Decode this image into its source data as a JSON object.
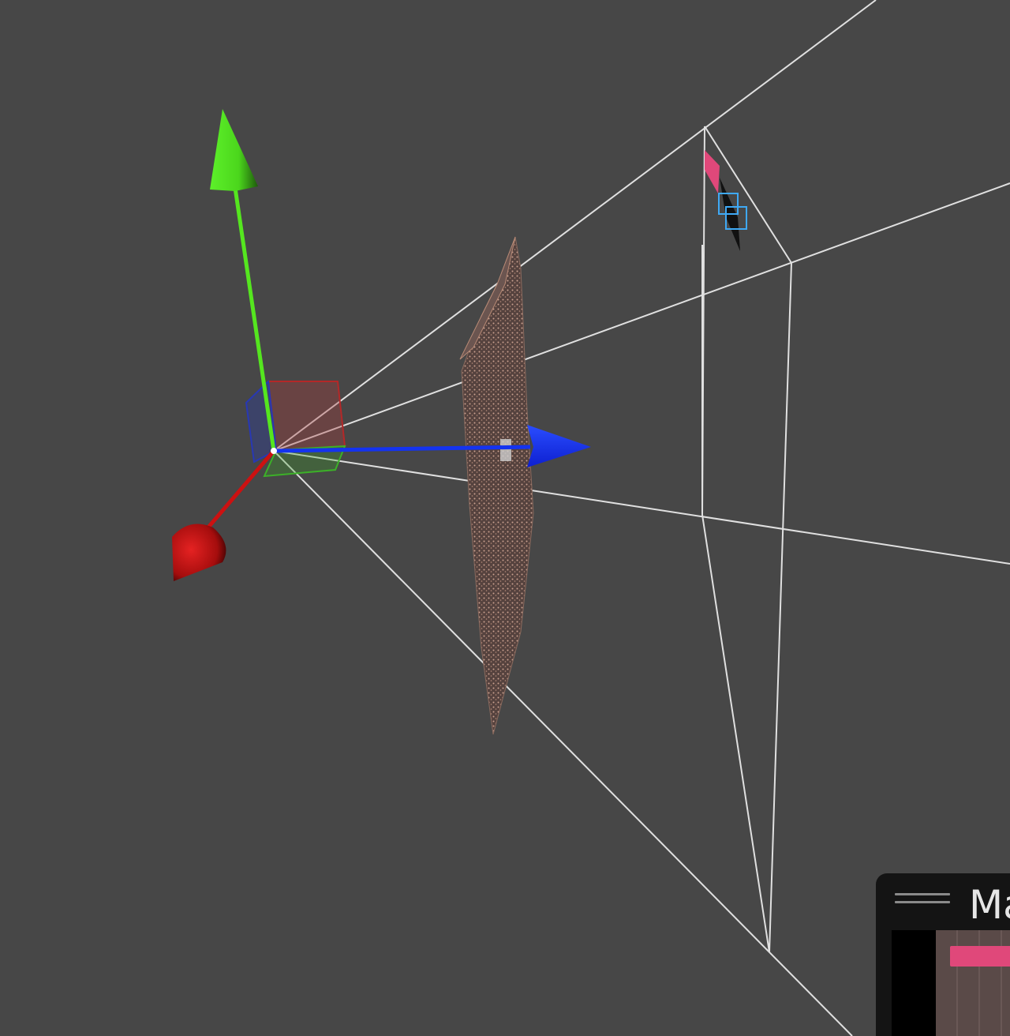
{
  "viewport": {
    "background_color": "#474747",
    "axis_colors": {
      "x": "#cc1111",
      "y": "#55e61f",
      "z": "#1433f0"
    },
    "frustum_color": "#e0e0e0",
    "point_cloud_color": "#9a7566",
    "selection_color": "#3fa9f5",
    "highlight_color": "#e0487a"
  },
  "panel": {
    "title": "Ma",
    "grip_icon": "drag-handle-icon",
    "accent_color": "#e0487a"
  }
}
